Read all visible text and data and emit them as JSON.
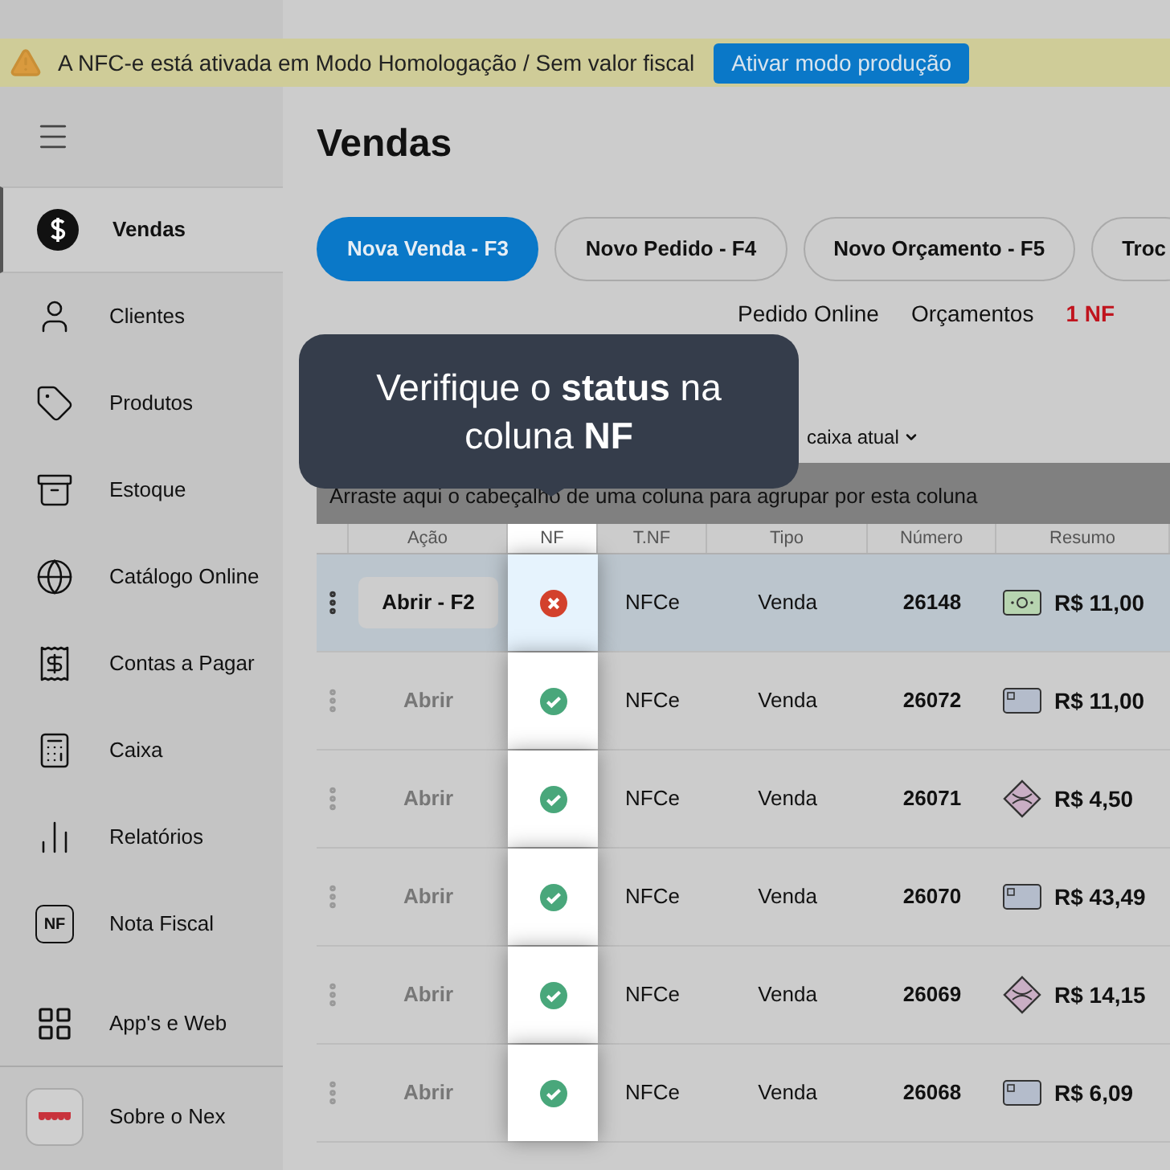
{
  "banner": {
    "message": "A NFC-e está ativada em Modo Homologação / Sem valor fiscal",
    "button": "Ativar modo produção"
  },
  "sidebar": {
    "items": [
      {
        "label": "Vendas",
        "selected": true
      },
      {
        "label": "Clientes",
        "selected": false
      },
      {
        "label": "Produtos",
        "selected": false
      },
      {
        "label": "Estoque",
        "selected": false
      },
      {
        "label": "Catálogo Online",
        "selected": false
      },
      {
        "label": "Contas a Pagar",
        "selected": false
      },
      {
        "label": "Caixa",
        "selected": false
      },
      {
        "label": "Relatórios",
        "selected": false
      },
      {
        "label": "Nota Fiscal",
        "selected": false,
        "badge": "NF"
      },
      {
        "label": "App's e Web",
        "selected": false
      }
    ],
    "footer": {
      "label": "Sobre o Nex"
    }
  },
  "page": {
    "title": "Vendas"
  },
  "actions": [
    {
      "label": "Nova Venda - F3",
      "primary": true
    },
    {
      "label": "Novo Pedido - F4",
      "primary": false
    },
    {
      "label": "Novo Orçamento - F5",
      "primary": false
    },
    {
      "label": "Troc",
      "primary": false
    }
  ],
  "tabs": [
    {
      "label": "Pedido Online",
      "alert": false
    },
    {
      "label": "Orçamentos",
      "alert": false
    },
    {
      "label": "1 NF",
      "alert": true
    }
  ],
  "filter": {
    "label": "caixa atual"
  },
  "group_bar": "Arraste aqui o cabeçalho de uma coluna para agrupar por esta coluna",
  "table": {
    "columns": [
      "Ação",
      "NF",
      "T.NF",
      "Tipo",
      "Número",
      "Resumo"
    ],
    "rows": [
      {
        "selected": true,
        "action": "Abrir - F2",
        "nf_ok": false,
        "tnf": "NFCe",
        "tipo": "Venda",
        "numero": "26148",
        "kind": "cash",
        "total": "R$ 11,00"
      },
      {
        "selected": false,
        "action": "Abrir",
        "nf_ok": true,
        "tnf": "NFCe",
        "tipo": "Venda",
        "numero": "26072",
        "kind": "card",
        "total": "R$ 11,00"
      },
      {
        "selected": false,
        "action": "Abrir",
        "nf_ok": true,
        "tnf": "NFCe",
        "tipo": "Venda",
        "numero": "26071",
        "kind": "pix",
        "total": "R$ 4,50"
      },
      {
        "selected": false,
        "action": "Abrir",
        "nf_ok": true,
        "tnf": "NFCe",
        "tipo": "Venda",
        "numero": "26070",
        "kind": "card",
        "total": "R$ 43,49"
      },
      {
        "selected": false,
        "action": "Abrir",
        "nf_ok": true,
        "tnf": "NFCe",
        "tipo": "Venda",
        "numero": "26069",
        "kind": "pix",
        "total": "R$ 14,15"
      },
      {
        "selected": false,
        "action": "Abrir",
        "nf_ok": true,
        "tnf": "NFCe",
        "tipo": "Venda",
        "numero": "26068",
        "kind": "card",
        "total": "R$ 6,09"
      }
    ]
  },
  "tooltip": {
    "text": "Verifique o **status** na coluna **NF**"
  }
}
